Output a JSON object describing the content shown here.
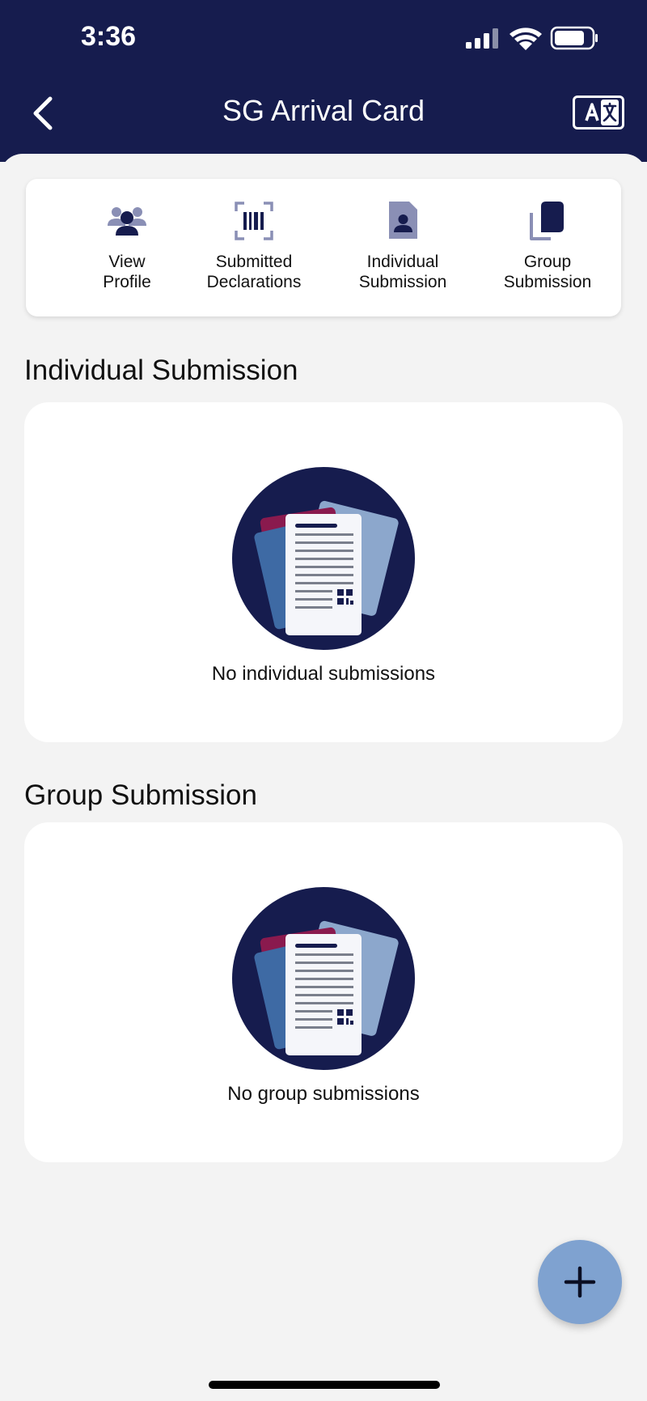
{
  "status_bar": {
    "time": "3:36"
  },
  "nav": {
    "title": "SG Arrival Card"
  },
  "quick_actions": [
    {
      "label": "View\nProfile",
      "icon": "people-icon"
    },
    {
      "label": "Submitted\nDeclarations",
      "icon": "barcode-scan-icon"
    },
    {
      "label": "Individual\nSubmission",
      "icon": "person-document-icon"
    },
    {
      "label": "Group\nSubmission",
      "icon": "copy-documents-icon"
    }
  ],
  "individual": {
    "heading": "Individual Submission",
    "empty_text": "No individual submissions"
  },
  "group": {
    "heading": "Group Submission",
    "empty_text": "No group submissions"
  },
  "colors": {
    "header_bg": "#161c4e",
    "fab_bg": "#7fa2d0",
    "page_bg": "#f3f3f3"
  },
  "fab": {
    "icon": "plus-icon"
  }
}
